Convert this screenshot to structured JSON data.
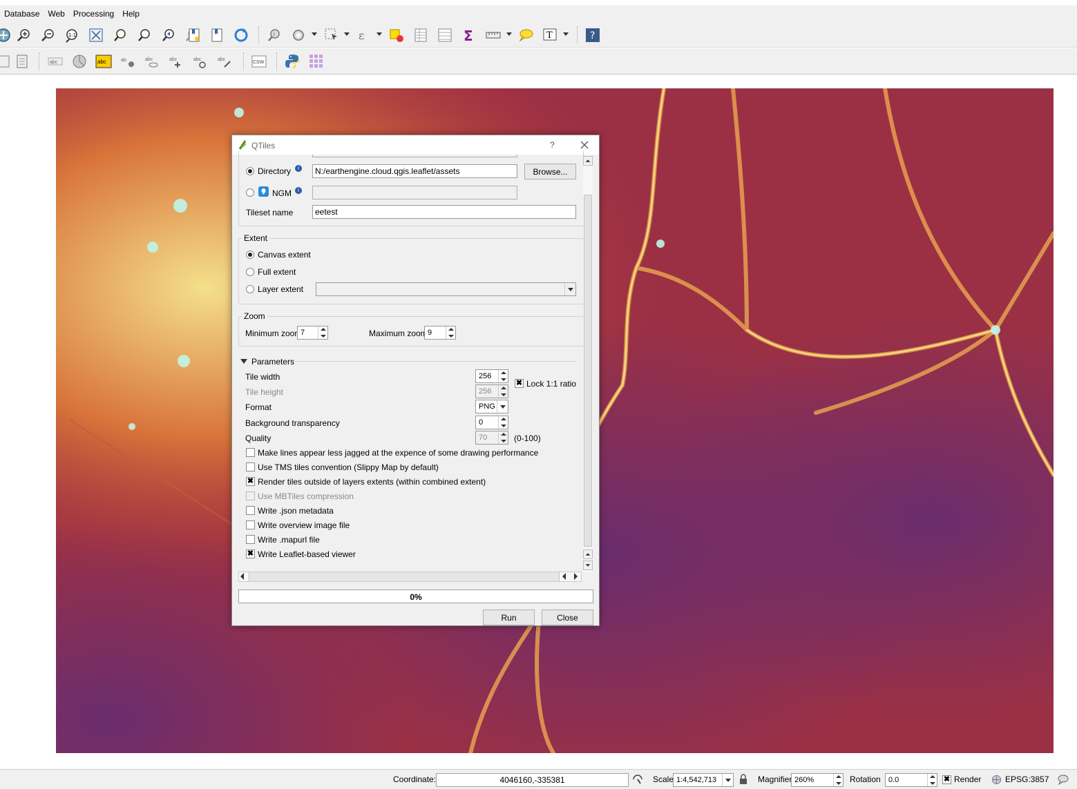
{
  "menubar": {
    "items": [
      "Database",
      "Web",
      "Processing",
      "Help"
    ]
  },
  "toolbar1": {
    "icons": [
      "pan-icon",
      "zoom-in-icon",
      "zoom-out-icon",
      "zoom-native-icon",
      "zoom-full-icon",
      "zoom-to-selection-icon",
      "zoom-to-layer-icon",
      "zoom-last-icon",
      "zoom-next-icon",
      "new-bookmark-icon",
      "show-bookmarks-icon",
      "refresh-icon",
      "identify-icon",
      "action-icon",
      "select-icon",
      "deselect-icon",
      "attribute-table-icon",
      "field-calculator-icon",
      "statistics-icon",
      "measure-icon",
      "annotation-icon",
      "text-annotation-icon",
      "help-icon"
    ]
  },
  "toolbar2": {
    "icons": [
      "layer-icon",
      "note-icon",
      "label-icon",
      "diagram-icon",
      "label-style-icon",
      "pin-label-icon",
      "show-hide-label-icon",
      "move-label-icon",
      "rotate-label-icon",
      "change-label-icon",
      "csw-icon",
      "python-icon",
      "grid-icon"
    ]
  },
  "dialog": {
    "title": "QTiles",
    "help_glyph": "?",
    "directory_label": "Directory",
    "directory_value": "N:/earthengine.cloud.qgis.leaflet/assets",
    "browse_label": "Browse...",
    "ngm_label": "NGM",
    "ngm_value": "",
    "tileset_label": "Tileset name",
    "tileset_value": "eetest",
    "extent_title": "Extent",
    "canvas_extent": "Canvas extent",
    "full_extent": "Full extent",
    "layer_extent": "Layer extent",
    "zoom_title": "Zoom",
    "min_zoom_label": "Minimum zoom",
    "min_zoom_value": "7",
    "max_zoom_label": "Maximum zoom",
    "max_zoom_value": "9",
    "params_title": "Parameters",
    "tile_width_label": "Tile width",
    "tile_width_value": "256",
    "tile_height_label": "Tile height",
    "tile_height_value": "256",
    "lock_label": "Lock 1:1 ratio",
    "format_label": "Format",
    "format_value": "PNG",
    "bg_label": "Background transparency",
    "bg_value": "0",
    "quality_label": "Quality",
    "quality_value": "70",
    "quality_range": "(0-100)",
    "options": [
      {
        "label": "Make lines appear less jagged at the expence of some drawing performance",
        "checked": false,
        "enabled": true
      },
      {
        "label": "Use TMS tiles convention (Slippy Map by default)",
        "checked": false,
        "enabled": true
      },
      {
        "label": "Render tiles outside of layers extents (within combined extent)",
        "checked": true,
        "enabled": true
      },
      {
        "label": "Use MBTiles compression",
        "checked": false,
        "enabled": false
      },
      {
        "label": "Write .json metadata",
        "checked": false,
        "enabled": true
      },
      {
        "label": "Write overview image file",
        "checked": false,
        "enabled": true
      },
      {
        "label": "Write .mapurl file",
        "checked": false,
        "enabled": true
      },
      {
        "label": "Write Leaflet-based viewer",
        "checked": true,
        "enabled": true
      }
    ],
    "progress_text": "0%",
    "progress": 0,
    "run_label": "Run",
    "close_label": "Close"
  },
  "statusbar": {
    "coordinate_label": "Coordinate:",
    "coordinate_value": "4046160,-335381",
    "scale_label": "Scale",
    "scale_value": "1:4,542,713",
    "magnifier_label": "Magnifier",
    "magnifier_value": "260%",
    "rotation_label": "Rotation",
    "rotation_value": "0.0",
    "render_label": "Render",
    "crs_label": "EPSG:3857"
  },
  "colors": {
    "map_low": "#6a2d6e",
    "map_mid": "#b23a3a",
    "map_high": "#f4e08a",
    "map_peak": "#bff5e8"
  }
}
